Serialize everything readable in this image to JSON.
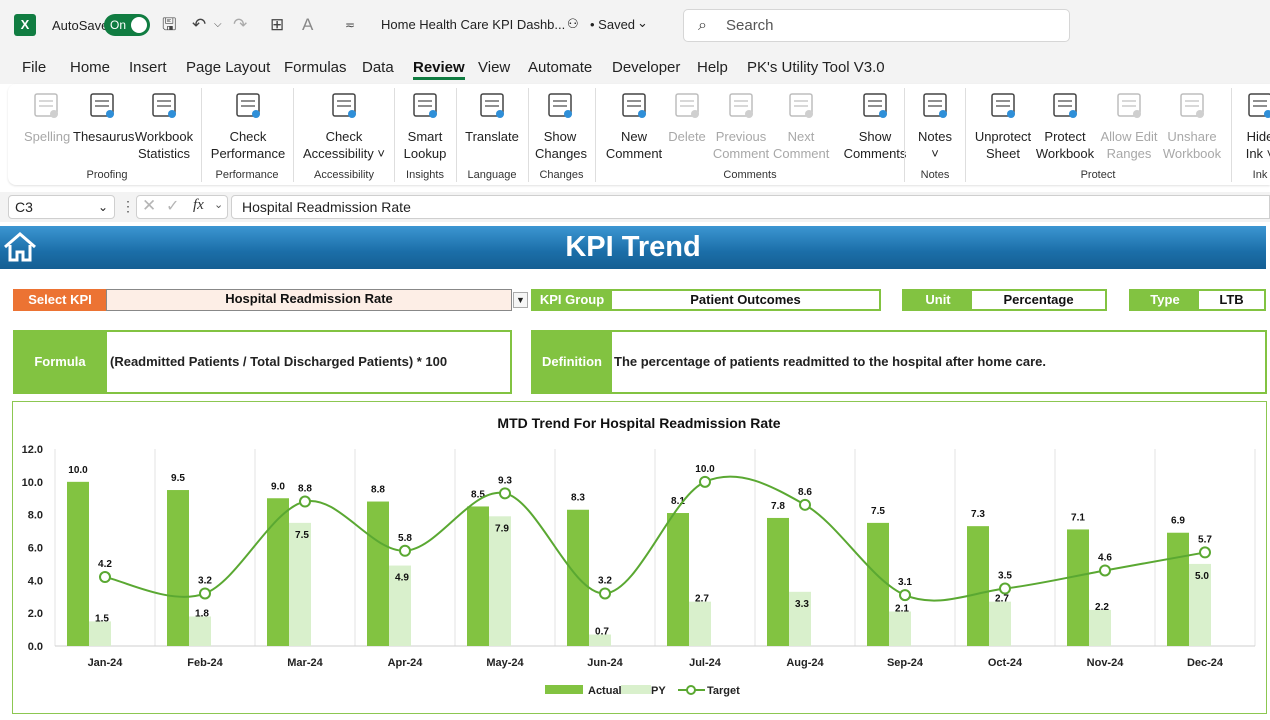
{
  "titlebar": {
    "app_logo": "X",
    "autosave_label": "AutoSave",
    "autosave_state": "On",
    "doc_title": "Home Health Care KPI Dashb...",
    "saved_label": "• Saved",
    "search_placeholder": "Search"
  },
  "menu": [
    "File",
    "Home",
    "Insert",
    "Page Layout",
    "Formulas",
    "Data",
    "Review",
    "View",
    "Automate",
    "Developer",
    "Help",
    "PK's Utility Tool V3.0"
  ],
  "ribbon": {
    "buttons": [
      {
        "l1": "Spelling",
        "l2": "",
        "icon": "spelling-icon",
        "enabled": false
      },
      {
        "l1": "Thesaurus",
        "l2": "",
        "icon": "thesaurus-icon",
        "enabled": true
      },
      {
        "l1": "Workbook",
        "l2": "Statistics",
        "icon": "workbook-statistics-icon",
        "enabled": true
      },
      {
        "l1": "Check",
        "l2": "Performance",
        "icon": "check-performance-icon",
        "enabled": true
      },
      {
        "l1": "Check",
        "l2": "Accessibility ˅",
        "icon": "accessibility-icon",
        "enabled": true
      },
      {
        "l1": "Smart",
        "l2": "Lookup",
        "icon": "smart-lookup-icon",
        "enabled": true
      },
      {
        "l1": "Translate",
        "l2": "",
        "icon": "translate-icon",
        "enabled": true
      },
      {
        "l1": "Show",
        "l2": "Changes",
        "icon": "show-changes-icon",
        "enabled": true
      },
      {
        "l1": "New",
        "l2": "Comment",
        "icon": "new-comment-icon",
        "enabled": true
      },
      {
        "l1": "Delete",
        "l2": "",
        "icon": "delete-comment-icon",
        "enabled": false
      },
      {
        "l1": "Previous",
        "l2": "Comment",
        "icon": "previous-comment-icon",
        "enabled": false
      },
      {
        "l1": "Next",
        "l2": "Comment",
        "icon": "next-comment-icon",
        "enabled": false
      },
      {
        "l1": "Show",
        "l2": "Comments",
        "icon": "show-comments-icon",
        "enabled": true
      },
      {
        "l1": "Notes",
        "l2": "˅",
        "icon": "notes-icon",
        "enabled": true
      },
      {
        "l1": "Unprotect",
        "l2": "Sheet",
        "icon": "unprotect-sheet-icon",
        "enabled": true
      },
      {
        "l1": "Protect",
        "l2": "Workbook",
        "icon": "protect-workbook-icon",
        "enabled": true
      },
      {
        "l1": "Allow Edit",
        "l2": "Ranges",
        "icon": "allow-edit-ranges-icon",
        "enabled": false
      },
      {
        "l1": "Unshare",
        "l2": "Workbook",
        "icon": "unshare-workbook-icon",
        "enabled": false
      },
      {
        "l1": "Hide",
        "l2": "Ink ˅",
        "icon": "hide-ink-icon",
        "enabled": true
      }
    ],
    "groups": [
      "Proofing",
      "Performance",
      "Accessibility",
      "Insights",
      "Language",
      "Changes",
      "Comments",
      "Notes",
      "Protect",
      "Ink"
    ]
  },
  "formula_bar": {
    "cell_ref": "C3",
    "formula": "Hospital Readmission Rate",
    "fx": "fx"
  },
  "sheet": {
    "title": "KPI Trend",
    "select_kpi_label": "Select KPI",
    "select_kpi_value": "Hospital Readmission Rate",
    "kpi_group_label": "KPI Group",
    "kpi_group_value": "Patient Outcomes",
    "unit_label": "Unit",
    "unit_value": "Percentage",
    "type_label": "Type",
    "type_value": "LTB",
    "formula_label": "Formula",
    "formula_value": "(Readmitted Patients / Total Discharged Patients) * 100",
    "definition_label": "Definition",
    "definition_value": "The percentage of patients readmitted to the hospital after home care."
  },
  "colors": {
    "actual": "#82c341",
    "py": "#d9f0cc",
    "target": "#5aa832",
    "label_orange": "#ec7333",
    "label_green": "#82c341",
    "banner": "#1b6ea8"
  },
  "chart_data": {
    "type": "bar",
    "title": "MTD Trend For Hospital Readmission Rate",
    "categories": [
      "Jan-24",
      "Feb-24",
      "Mar-24",
      "Apr-24",
      "May-24",
      "Jun-24",
      "Jul-24",
      "Aug-24",
      "Sep-24",
      "Oct-24",
      "Nov-24",
      "Dec-24"
    ],
    "series": [
      {
        "name": "Actual",
        "type": "bar",
        "values": [
          10.0,
          9.5,
          9.0,
          8.8,
          8.5,
          8.3,
          8.1,
          7.8,
          7.5,
          7.3,
          7.1,
          6.9
        ]
      },
      {
        "name": "PY",
        "type": "bar",
        "values": [
          1.5,
          1.8,
          7.5,
          4.9,
          7.9,
          0.7,
          2.7,
          3.3,
          2.1,
          2.7,
          2.2,
          5.0
        ]
      },
      {
        "name": "Target",
        "type": "line",
        "values": [
          4.2,
          3.2,
          8.8,
          5.8,
          9.3,
          3.2,
          10.0,
          8.6,
          3.1,
          3.5,
          4.6,
          5.7
        ]
      }
    ],
    "ylim": [
      0,
      12
    ],
    "yticks": [
      "0.0",
      "2.0",
      "4.0",
      "6.0",
      "8.0",
      "10.0",
      "12.0"
    ],
    "grid": "vertical",
    "legend": "bottom"
  }
}
